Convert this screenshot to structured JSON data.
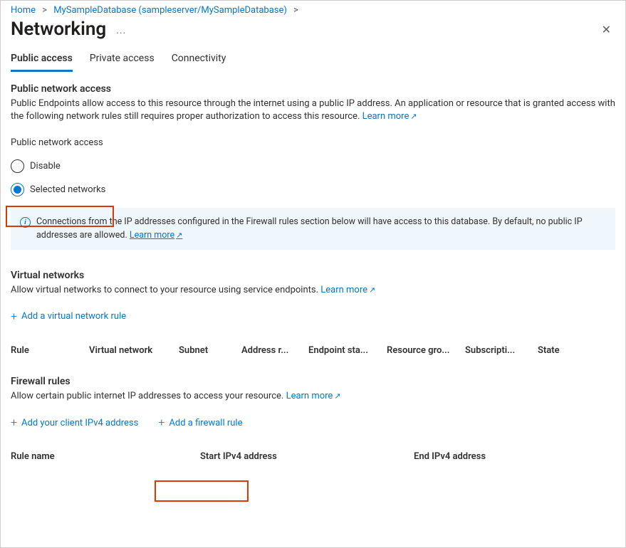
{
  "breadcrumb": {
    "home": "Home",
    "resource": "MySampleDatabase (sampleserver/MySampleDatabase)"
  },
  "page_title": "Networking",
  "tabs": [
    {
      "label": "Public access",
      "active": true
    },
    {
      "label": "Private access",
      "active": false
    },
    {
      "label": "Connectivity",
      "active": false
    }
  ],
  "public_access": {
    "heading": "Public network access",
    "description": "Public Endpoints allow access to this resource through the internet using a public IP address. An application or resource that is granted access with the following network rules still requires proper authorization to access this resource. ",
    "learn_more": "Learn more",
    "field_label": "Public network access",
    "options": {
      "disable": "Disable",
      "selected_networks": "Selected networks"
    },
    "selected": "selected_networks",
    "callout": "Connections from the IP addresses configured in the Firewall rules section below will have access to this database. By default, no public IP addresses are allowed.  ",
    "callout_link": "Learn more"
  },
  "virtual_networks": {
    "heading": "Virtual networks",
    "description": "Allow virtual networks to connect to your resource using service endpoints. ",
    "learn_more": "Learn more",
    "add_rule": "Add a virtual network rule",
    "columns": [
      "Rule",
      "Virtual network",
      "Subnet",
      "Address r...",
      "Endpoint sta...",
      "Resource gro...",
      "Subscripti...",
      "State"
    ]
  },
  "firewall_rules": {
    "heading": "Firewall rules",
    "description": "Allow certain public internet IP addresses to access your resource. ",
    "learn_more": "Learn more",
    "add_client_ip": "Add your client IPv4 address",
    "add_rule": "Add a firewall rule",
    "columns": [
      "Rule name",
      "Start IPv4 address",
      "End IPv4 address"
    ]
  }
}
